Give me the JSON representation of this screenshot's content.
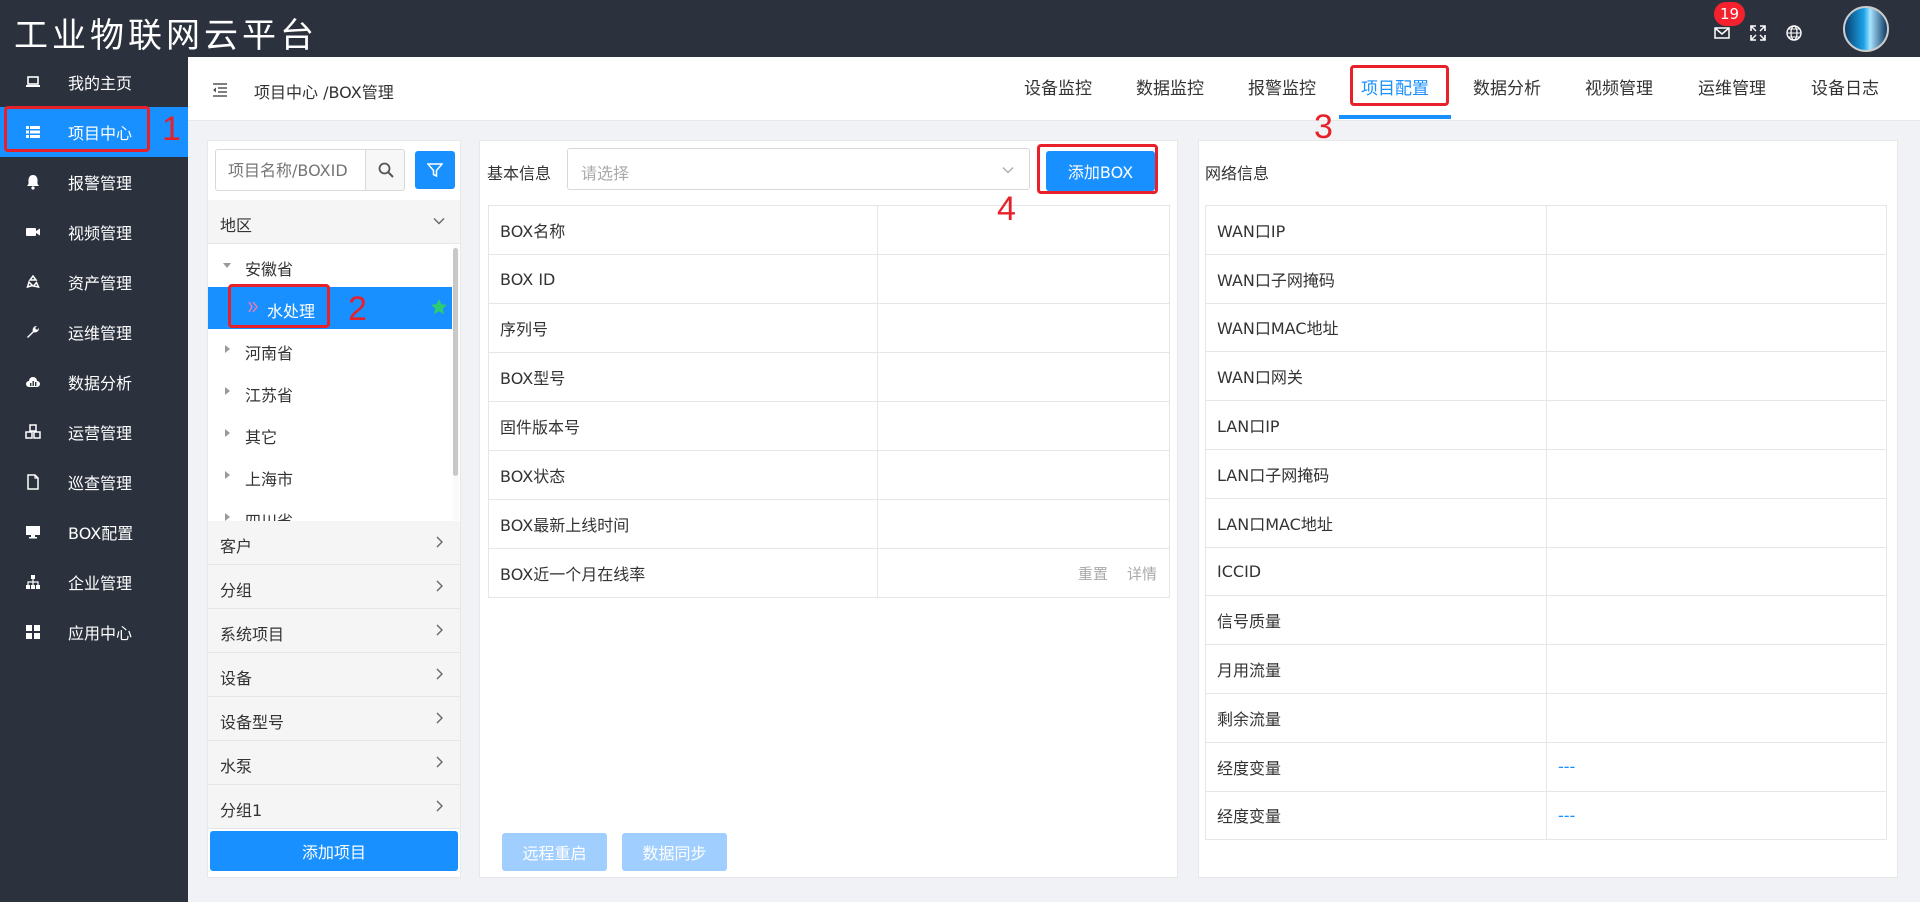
{
  "app": {
    "title": "工业物联网云平台",
    "notification_count": "19"
  },
  "sidebar": {
    "items": [
      {
        "label": "我的主页",
        "icon": "laptop-icon"
      },
      {
        "label": "项目中心",
        "icon": "list-icon",
        "active": true
      },
      {
        "label": "报警管理",
        "icon": "bell-icon"
      },
      {
        "label": "视频管理",
        "icon": "video-icon"
      },
      {
        "label": "资产管理",
        "icon": "recycle-icon"
      },
      {
        "label": "运维管理",
        "icon": "wrench-icon"
      },
      {
        "label": "数据分析",
        "icon": "cloud-chart-icon"
      },
      {
        "label": "运营管理",
        "icon": "cubes-icon"
      },
      {
        "label": "巡查管理",
        "icon": "file-icon"
      },
      {
        "label": "BOX配置",
        "icon": "monitor-icon"
      },
      {
        "label": "企业管理",
        "icon": "sitemap-icon"
      },
      {
        "label": "应用中心",
        "icon": "grid-icon"
      }
    ]
  },
  "header": {
    "breadcrumb": "项目中心 /BOX管理",
    "tabs": [
      "设备监控",
      "数据监控",
      "报警监控",
      "项目配置",
      "数据分析",
      "视频管理",
      "运维管理",
      "设备日志"
    ],
    "active_tab": "项目配置"
  },
  "left": {
    "search_placeholder": "项目名称/BOXID",
    "region_label": "地区",
    "tree": [
      {
        "label": "安徽省",
        "expanded": true
      },
      {
        "label": "水处理",
        "selected": true
      },
      {
        "label": "河南省"
      },
      {
        "label": "江苏省"
      },
      {
        "label": "其它"
      },
      {
        "label": "上海市"
      },
      {
        "label": "四川省"
      }
    ],
    "groups": [
      "客户",
      "分组",
      "系统项目",
      "设备",
      "设备型号",
      "水泵",
      "分组1"
    ],
    "add_project": "添加项目"
  },
  "center": {
    "label": "基本信息",
    "select_placeholder": "请选择",
    "add_box": "添加BOX",
    "rows": [
      "BOX名称",
      "BOX ID",
      "序列号",
      "BOX型号",
      "固件版本号",
      "BOX状态",
      "BOX最新上线时间",
      "BOX近一个月在线率"
    ],
    "reset": "重置",
    "details": "详情",
    "remote_restart": "远程重启",
    "data_sync": "数据同步"
  },
  "right": {
    "label": "网络信息",
    "rows": [
      {
        "k": "WAN口IP",
        "v": ""
      },
      {
        "k": "WAN口子网掩码",
        "v": ""
      },
      {
        "k": "WAN口MAC地址",
        "v": ""
      },
      {
        "k": "WAN口网关",
        "v": ""
      },
      {
        "k": "LAN口IP",
        "v": ""
      },
      {
        "k": "LAN口子网掩码",
        "v": ""
      },
      {
        "k": "LAN口MAC地址",
        "v": ""
      },
      {
        "k": "ICCID",
        "v": ""
      },
      {
        "k": "信号质量",
        "v": ""
      },
      {
        "k": "月用流量",
        "v": ""
      },
      {
        "k": "剩余流量",
        "v": ""
      },
      {
        "k": "经度变量",
        "v": "---"
      },
      {
        "k": "经度变量",
        "v": "---"
      }
    ]
  },
  "annotations": [
    "1",
    "2",
    "3",
    "4"
  ],
  "colors": {
    "accent": "#1890ff",
    "sidebar_bg": "#2b313d",
    "annotation": "#e8202a",
    "star": "#2ecc71"
  }
}
